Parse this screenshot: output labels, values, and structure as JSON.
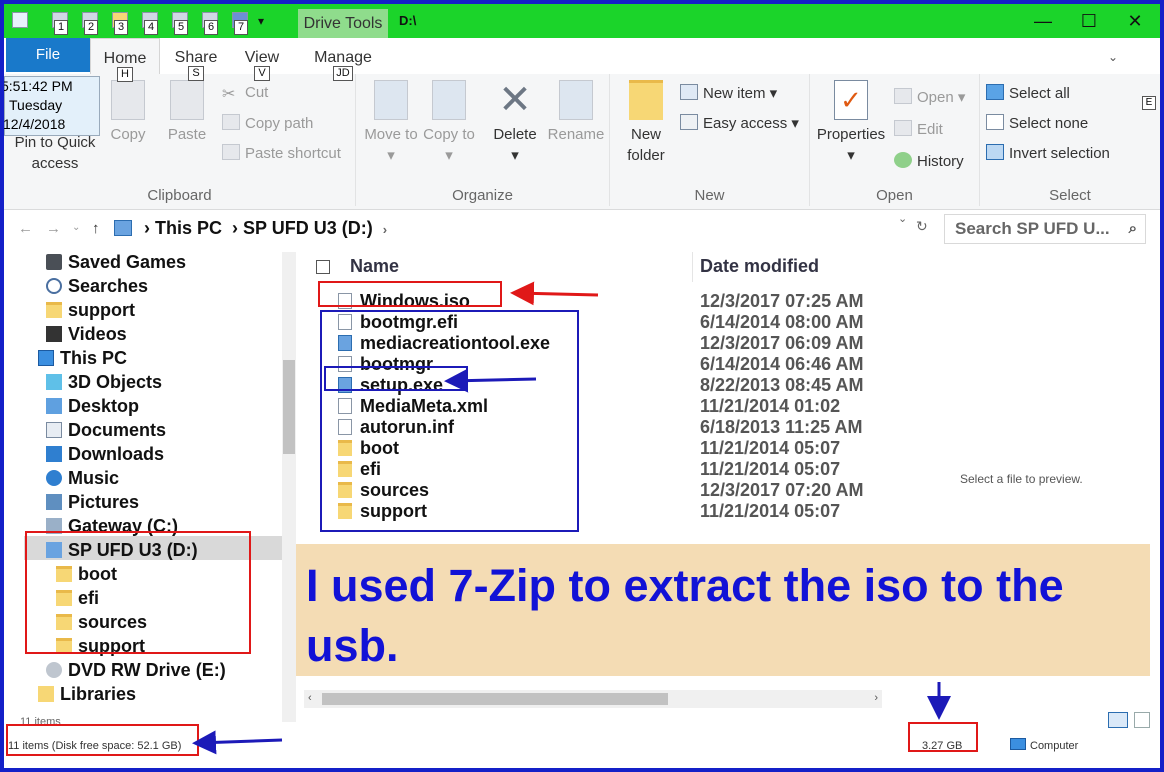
{
  "window": {
    "contextual_tab": "Drive Tools",
    "title": "D:\\",
    "quick_access_keys": [
      "1",
      "2",
      "3",
      "4",
      "5",
      "6",
      "7"
    ]
  },
  "clock": {
    "time": "5:51:42 PM",
    "day": "Tuesday",
    "date": "12/4/2018"
  },
  "tabs": [
    {
      "label": "File"
    },
    {
      "label": "Home",
      "key": "H"
    },
    {
      "label": "Share",
      "key": "S"
    },
    {
      "label": "View",
      "key": "V"
    },
    {
      "label": "Manage",
      "key": "JD"
    }
  ],
  "ribbon": {
    "clipboard": {
      "label": "Clipboard",
      "pin": "Pin to Quick access",
      "copy": "Copy",
      "paste": "Paste",
      "cut": "Cut",
      "copy_path": "Copy path",
      "paste_shortcut": "Paste shortcut"
    },
    "organize": {
      "label": "Organize",
      "move_to": "Move to",
      "copy_to": "Copy to",
      "delete": "Delete",
      "rename": "Rename"
    },
    "new": {
      "label": "New",
      "new_folder": "New folder",
      "new_item": "New item",
      "easy_access": "Easy access"
    },
    "open": {
      "label": "Open",
      "properties": "Properties",
      "open": "Open",
      "edit": "Edit",
      "history": "History"
    },
    "select": {
      "label": "Select",
      "select_all": "Select all",
      "select_none": "Select none",
      "invert": "Invert selection"
    }
  },
  "address": {
    "crumbs": [
      "This PC",
      "SP UFD U3 (D:)"
    ],
    "search_placeholder": "Search SP UFD U..."
  },
  "nav": [
    {
      "label": "Saved Games",
      "indent": 1
    },
    {
      "label": "Searches",
      "indent": 1
    },
    {
      "label": "support",
      "indent": 1
    },
    {
      "label": "Videos",
      "indent": 1
    },
    {
      "label": "This PC",
      "indent": 0
    },
    {
      "label": "3D Objects",
      "indent": 1
    },
    {
      "label": "Desktop",
      "indent": 1
    },
    {
      "label": "Documents",
      "indent": 1
    },
    {
      "label": "Downloads",
      "indent": 1
    },
    {
      "label": "Music",
      "indent": 1
    },
    {
      "label": "Pictures",
      "indent": 1
    },
    {
      "label": "Gateway (C:)",
      "indent": 1
    },
    {
      "label": "SP UFD U3 (D:)",
      "indent": 1
    },
    {
      "label": "boot",
      "indent": 2
    },
    {
      "label": "efi",
      "indent": 2
    },
    {
      "label": "sources",
      "indent": 2
    },
    {
      "label": "support",
      "indent": 2
    },
    {
      "label": "DVD RW Drive (E:)",
      "indent": 1
    },
    {
      "label": "Libraries",
      "indent": 0
    }
  ],
  "columns": {
    "name": "Name",
    "date": "Date modified"
  },
  "files": [
    {
      "name": "Windows.iso",
      "date": "12/3/2017 07:25 AM",
      "kind": "file"
    },
    {
      "name": "bootmgr.efi",
      "date": "6/14/2014 08:00 AM",
      "kind": "file"
    },
    {
      "name": "mediacreationtool.exe",
      "date": "12/3/2017 06:09 AM",
      "kind": "exe"
    },
    {
      "name": "bootmgr",
      "date": "6/14/2014 06:46 AM",
      "kind": "file"
    },
    {
      "name": "setup.exe",
      "date": "8/22/2013 08:45 AM",
      "kind": "exe"
    },
    {
      "name": "MediaMeta.xml",
      "date": "11/21/2014 01:02",
      "kind": "file"
    },
    {
      "name": "autorun.inf",
      "date": "6/18/2013 11:25 AM",
      "kind": "file"
    },
    {
      "name": "boot",
      "date": "11/21/2014 05:07",
      "kind": "folder"
    },
    {
      "name": "efi",
      "date": "11/21/2014 05:07",
      "kind": "folder"
    },
    {
      "name": "sources",
      "date": "12/3/2017 07:20 AM",
      "kind": "folder"
    },
    {
      "name": "support",
      "date": "11/21/2014 05:07",
      "kind": "folder"
    }
  ],
  "preview_text": "Select a file to preview.",
  "note": "I used 7-Zip to extract the iso to the usb.",
  "status": {
    "items_small": "11 items",
    "items_free": "11 items (Disk free space: 52.1 GB)",
    "size": "3.27 GB",
    "computer": "Computer"
  }
}
